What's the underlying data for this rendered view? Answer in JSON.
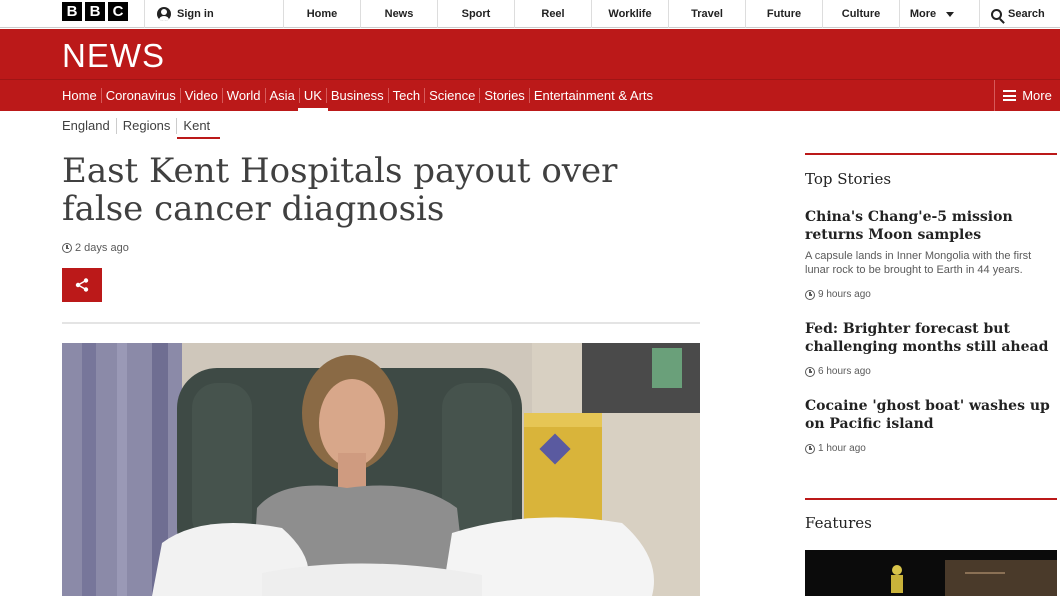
{
  "brand": {
    "letters": [
      "B",
      "B",
      "C"
    ]
  },
  "account": {
    "signin_label": "Sign in"
  },
  "top_nav": {
    "items": [
      "Home",
      "News",
      "Sport",
      "Reel",
      "Worklife",
      "Travel",
      "Future",
      "Culture"
    ],
    "more_label": "More",
    "search_label": "Search"
  },
  "news_banner": {
    "title": "NEWS"
  },
  "section_nav": {
    "items": [
      "Home",
      "Coronavirus",
      "Video",
      "World",
      "Asia",
      "UK",
      "Business",
      "Tech",
      "Science",
      "Stories",
      "Entertainment & Arts"
    ],
    "active": "UK",
    "more_label": "More"
  },
  "breadcrumb": {
    "items": [
      "England",
      "Regions",
      "Kent"
    ],
    "active": "Kent"
  },
  "article": {
    "headline": "East Kent Hospitals payout over false cancer diagnosis",
    "timestamp": "2 days ago"
  },
  "sidebar": {
    "top_stories_heading": "Top Stories",
    "stories": [
      {
        "title": "China's Chang'e-5 mission returns Moon samples",
        "summary": "A capsule lands in Inner Mongolia with the first lunar rock to be brought to Earth in 44 years.",
        "time": "9 hours ago"
      },
      {
        "title": "Fed: Brighter forecast but challenging months still ahead",
        "time": "6 hours ago"
      },
      {
        "title": "Cocaine 'ghost boat' washes up on Pacific island",
        "time": "1 hour ago"
      }
    ],
    "features_heading": "Features"
  },
  "colors": {
    "bbc_red": "#bb1919",
    "text_dark": "#404040",
    "text_muted": "#5a5a5a"
  }
}
